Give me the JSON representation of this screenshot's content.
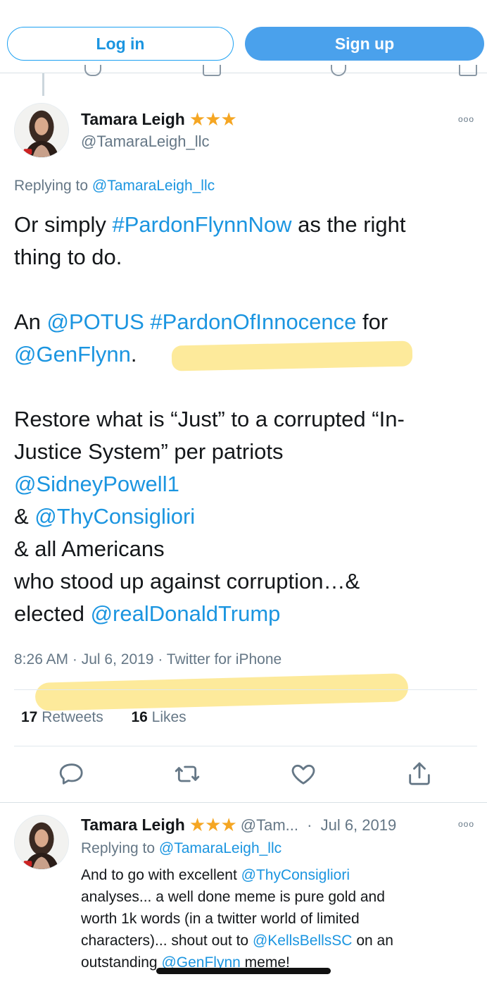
{
  "auth": {
    "login_label": "Log in",
    "signup_label": "Sign up"
  },
  "main_tweet": {
    "name": "Tamara Leigh",
    "stars": "★★★",
    "handle": "@TamaraLeigh_llc",
    "more_label": "ooo",
    "replying_prefix": "Replying to",
    "replying_handle": "@TamaraLeigh_llc",
    "text": {
      "l1_a": "Or simply ",
      "l1_b": "#PardonFlynnNow",
      "l1_c": " as the right",
      "l2": "thing to do.",
      "l3_a": "An ",
      "l3_b": "@POTUS",
      "l3_c": " ",
      "l3_d": "#PardonOfInnocence",
      "l3_e": " for",
      "l4_a": "@GenFlynn",
      "l4_b": ".",
      "l5": "Restore what is “Just” to a corrupted “In-",
      "l6": "Justice System” per patriots",
      "l7": "@SidneyPowell1",
      "l8_a": "& ",
      "l8_b": "@ThyConsigliori",
      "l9": "& all Americans",
      "l10": "who stood up against corruption…&",
      "l11_a": "elected ",
      "l11_b": "@realDonaldTrump"
    },
    "time": "8:26 AM",
    "date": "Jul 6, 2019",
    "source": "Twitter for iPhone",
    "retweets_count": "17",
    "retweets_label": "Retweets",
    "likes_count": "16",
    "likes_label": "Likes"
  },
  "reply_tweet": {
    "name": "Tamara Leigh",
    "stars": "★★★",
    "handle": "@Tam...",
    "date": "Jul 6, 2019",
    "more_label": "ooo",
    "replying_prefix": "Replying to",
    "replying_handle": "@TamaraLeigh_llc",
    "text": {
      "l1_a": "And to go with excellent ",
      "l1_b": "@ThyConsigliori",
      "l2": "analyses... a well done meme is pure gold and",
      "l3": "worth 1k words (in a twitter world of limited",
      "l4_a": "characters)...  shout out to ",
      "l4_b": "@KellsBellsSC",
      "l4_c": " on an",
      "l5_a": "outstanding ",
      "l5_b": "@GenFlynn",
      "l5_c": " meme!"
    }
  },
  "colors": {
    "accent": "#1b95e0",
    "signup_bg": "#4aa1ec",
    "star": "#f5a623",
    "highlight": "#fde68a",
    "muted": "#657786"
  }
}
